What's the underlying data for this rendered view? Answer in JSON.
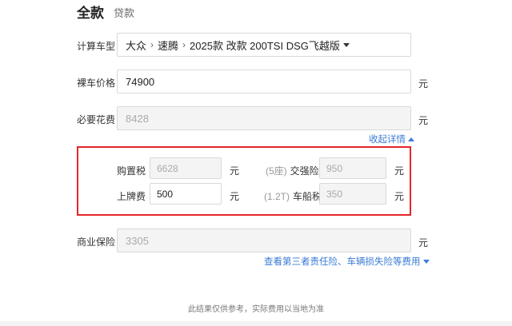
{
  "tabs": {
    "full": "全款",
    "loan": "贷款"
  },
  "car": {
    "label": "计算车型",
    "brand": "大众",
    "series": "速腾",
    "model": "2025款 改款 200TSI DSG飞越版"
  },
  "bare_price": {
    "label": "裸车价格",
    "value": "74900",
    "unit": "元"
  },
  "necessary_fees": {
    "label": "必要花费",
    "value": "8428",
    "unit": "元"
  },
  "collapse_link": "收起详情",
  "details": {
    "purchase_tax": {
      "label": "购置税",
      "value": "6628",
      "unit": "元"
    },
    "license_fee": {
      "label": "上牌费",
      "value": "500",
      "unit": "元"
    },
    "compulsory_insurance": {
      "note": "(5座)",
      "label": "交强险",
      "value": "950",
      "unit": "元"
    },
    "vehicle_tax": {
      "note": "(1.2T)",
      "label": "车船税",
      "value": "350",
      "unit": "元"
    }
  },
  "commercial_insurance": {
    "label": "商业保险",
    "value": "3305",
    "unit": "元"
  },
  "insurance_link": "查看第三者责任险、车辆损失险等费用",
  "footer": "此结果仅供参考，实际费用以当地为准",
  "colors": {
    "accent_link": "#3a7bd5",
    "highlight_border": "#e5252a"
  }
}
